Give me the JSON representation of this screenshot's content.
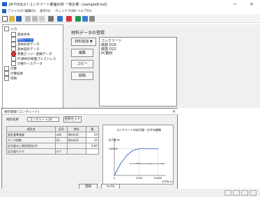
{
  "window": {
    "title": "JIP-TOOLS I コンクリート断面の材 一体計量 - [sample8.tsd]",
    "minimize_glyph": "−",
    "close_glyph": "×"
  },
  "menu": [
    "ファイル(F)",
    "編集(E)",
    "表示(V)",
    "ウィンドウ(W)",
    "ヘルプ(H)"
  ],
  "tree": {
    "root": "入力",
    "items": [
      {
        "label": "基本条件",
        "level": 1
      },
      {
        "label": "材料データ",
        "level": 1,
        "selected": true
      },
      {
        "label": "基本形状データ",
        "level": 1
      },
      {
        "label": "基本型形データ",
        "level": 1
      },
      {
        "label": "荷重ピンジ・配線データ",
        "level": 1
      },
      {
        "label": "PC鋼材の断面プレストレス",
        "level": 1
      },
      {
        "label": "計算ケースデータ",
        "level": 1
      },
      {
        "label": "計算",
        "level": 0
      },
      {
        "label": "計算結果",
        "level": 0
      },
      {
        "label": "印刷",
        "level": 0
      }
    ]
  },
  "material_panel": {
    "title": "材料データの登録",
    "buttons": {
      "add": "材料追加 ▼",
      "edit": "編集",
      "copy": "コピー",
      "delete": "削除"
    },
    "list": [
      "コンクリート",
      "鉄筋 D16",
      "鉄筋 D22",
      "PC鋼材"
    ]
  },
  "dialog": {
    "title": "材料登録 [コンクリート]",
    "name_label": "材料名称",
    "name_value": "コンクリート24",
    "select_button": "名称セット",
    "table": {
      "headers": [
        "項目名",
        "記号",
        "単位",
        "値"
      ],
      "rows": [
        [
          "設計基準強度",
          "σck",
          "N/mm2",
          "24"
        ],
        [
          "ヤング係数",
          "Ec",
          "N/mm2",
          "25"
        ],
        [
          "応力度の上限(許容応力)",
          "",
          "",
          "0.85"
        ],
        [
          "応力度モデル",
          "ﾀｲﾌﾟ",
          "",
          ""
        ]
      ]
    },
    "ok": "登録",
    "cancel": "ｷｬﾝｾﾙ"
  },
  "chart": {
    "title": "コンクリートの応力度－ひずみ曲線",
    "y_label": "応力度 σc",
    "x_label": "ひずみ εc",
    "peak_label": "0.85fck",
    "formula": "σc=0.85fck(εc/0.002)(2-εc/0.002)",
    "x_ticks": [
      "0",
      "0.002",
      "0.0035"
    ]
  },
  "chart_data": {
    "type": "line",
    "title": "コンクリートの応力度－ひずみ曲線",
    "xlabel": "ひずみ εc",
    "ylabel": "応力度 σc",
    "x": [
      0,
      0.0005,
      0.001,
      0.0015,
      0.002,
      0.0035
    ],
    "series": [
      {
        "values": [
          0,
          0.44,
          0.75,
          0.94,
          1.0,
          1.0
        ]
      }
    ],
    "xlim": [
      0,
      0.0038
    ],
    "ylim": [
      0,
      1.15
    ]
  }
}
